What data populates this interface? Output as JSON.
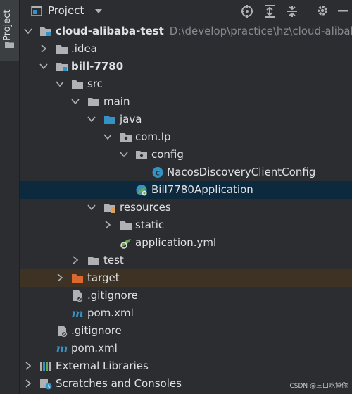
{
  "sidebar": {
    "tab_label": "Project"
  },
  "header": {
    "title": "Project"
  },
  "tree": {
    "root": {
      "name": "cloud-alibaba-test",
      "path": "D:\\develop\\practice\\hz\\cloud-alibaba"
    },
    "idea": ".idea",
    "module": "bill-7780",
    "src": "src",
    "main": "main",
    "java": "java",
    "pkg": "com.lp",
    "config": "config",
    "nacos_class": "NacosDiscoveryClientConfig",
    "app_class": "Bill7780Application",
    "resources": "resources",
    "static": "static",
    "app_yml": "application.yml",
    "test": "test",
    "target": "target",
    "gitignore_module": ".gitignore",
    "pom_module": "pom.xml",
    "gitignore_root": ".gitignore",
    "pom_root": "pom.xml",
    "ext_libs": "External Libraries",
    "scratches": "Scratches and Consoles"
  },
  "watermark": "CSDN @三口吃掉你",
  "colors": {
    "selected_row": "#0d293e",
    "excluded_row": "#3d3223",
    "target_folder": "#d9692f"
  }
}
